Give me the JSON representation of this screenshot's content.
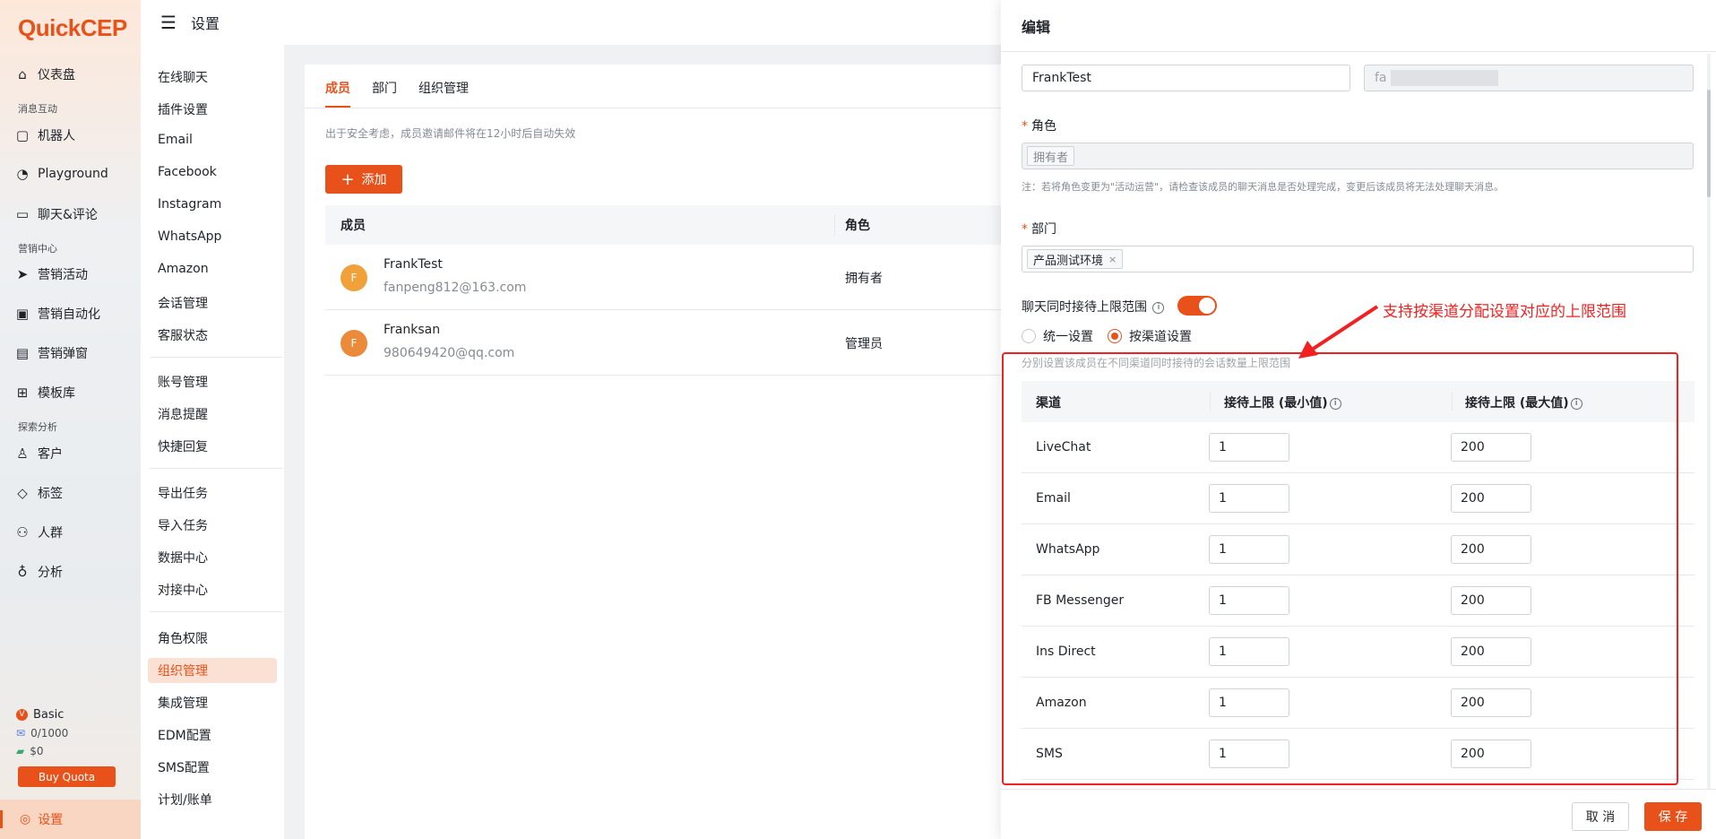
{
  "app": {
    "logo": "QuickCEP",
    "page_title": "设置"
  },
  "sidebar": {
    "items": [
      {
        "label": "仪表盘",
        "icon": "home-icon"
      },
      {
        "label": "机器人",
        "icon": "robot-icon"
      },
      {
        "label": "Playground",
        "icon": "playground-icon"
      },
      {
        "label": "聊天&评论",
        "icon": "chat-icon"
      },
      {
        "label": "营销活动",
        "icon": "send-icon"
      },
      {
        "label": "营销自动化",
        "icon": "automation-icon"
      },
      {
        "label": "营销弹窗",
        "icon": "popup-icon"
      },
      {
        "label": "模板库",
        "icon": "template-icon"
      },
      {
        "label": "客户",
        "icon": "user-icon"
      },
      {
        "label": "标签",
        "icon": "tag-icon"
      },
      {
        "label": "人群",
        "icon": "group-icon"
      },
      {
        "label": "分析",
        "icon": "bulb-icon"
      }
    ],
    "groups": [
      "消息互动",
      "营销中心",
      "探索分析"
    ],
    "plan": {
      "name": "Basic",
      "quota": "0/1000",
      "balance": "$0",
      "buy_label": "Buy Quota"
    },
    "settings_label": "设置"
  },
  "submenu": {
    "items": [
      "在线聊天",
      "插件设置",
      "Email",
      "Facebook",
      "Instagram",
      "WhatsApp",
      "Amazon",
      "会话管理",
      "客服状态",
      "账号管理",
      "消息提醒",
      "快捷回复",
      "导出任务",
      "导入任务",
      "数据中心",
      "对接中心",
      "角色权限",
      "组织管理",
      "集成管理",
      "EDM配置",
      "SMS配置",
      "计划/账单"
    ],
    "active": "组织管理"
  },
  "members": {
    "tabs": [
      "成员",
      "部门",
      "组织管理"
    ],
    "hint": "出于安全考虑，成员邀请邮件将在12小时后自动失效",
    "add_label": "添加",
    "columns": [
      "成员",
      "角色"
    ],
    "rows": [
      {
        "initial": "F",
        "name": "FrankTest",
        "email": "fanpeng812@163.com",
        "role": "拥有者"
      },
      {
        "initial": "F",
        "name": "Franksan",
        "email": "980649420@qq.com",
        "role": "管理员"
      }
    ]
  },
  "drawer": {
    "title": "编辑",
    "name_value": "FrankTest",
    "email_value": "fa",
    "role_label": "角色",
    "role_tag": "拥有者",
    "role_note": "注：若将角色变更为\"活动运营\"，请检查该成员的聊天消息是否处理完成，变更后该成员将无法处理聊天消息。",
    "dept_label": "部门",
    "dept_tag": "产品测试环境",
    "limit_label": "聊天同时接待上限范围",
    "radio_unified": "统一设置",
    "radio_channel": "按渠道设置",
    "channel_hint": "分别设置该成员在不同渠道同时接待的会话数量上限范围",
    "col_channel": "渠道",
    "col_min": "接待上限 (最小值)",
    "col_max": "接待上限 (最大值)",
    "channels": [
      {
        "name": "LiveChat",
        "min": "1",
        "max": "200"
      },
      {
        "name": "Email",
        "min": "1",
        "max": "200"
      },
      {
        "name": "WhatsApp",
        "min": "1",
        "max": "200"
      },
      {
        "name": "FB Messenger",
        "min": "1",
        "max": "200"
      },
      {
        "name": "Ins Direct",
        "min": "1",
        "max": "200"
      },
      {
        "name": "Amazon",
        "min": "1",
        "max": "200"
      },
      {
        "name": "SMS",
        "min": "1",
        "max": "200"
      }
    ],
    "cancel_label": "取 消",
    "save_label": "保 存"
  },
  "annotation": "支持按渠道分配设置对应的上限范围",
  "colors": {
    "accent": "#e8521a",
    "annotation": "#f32020"
  }
}
